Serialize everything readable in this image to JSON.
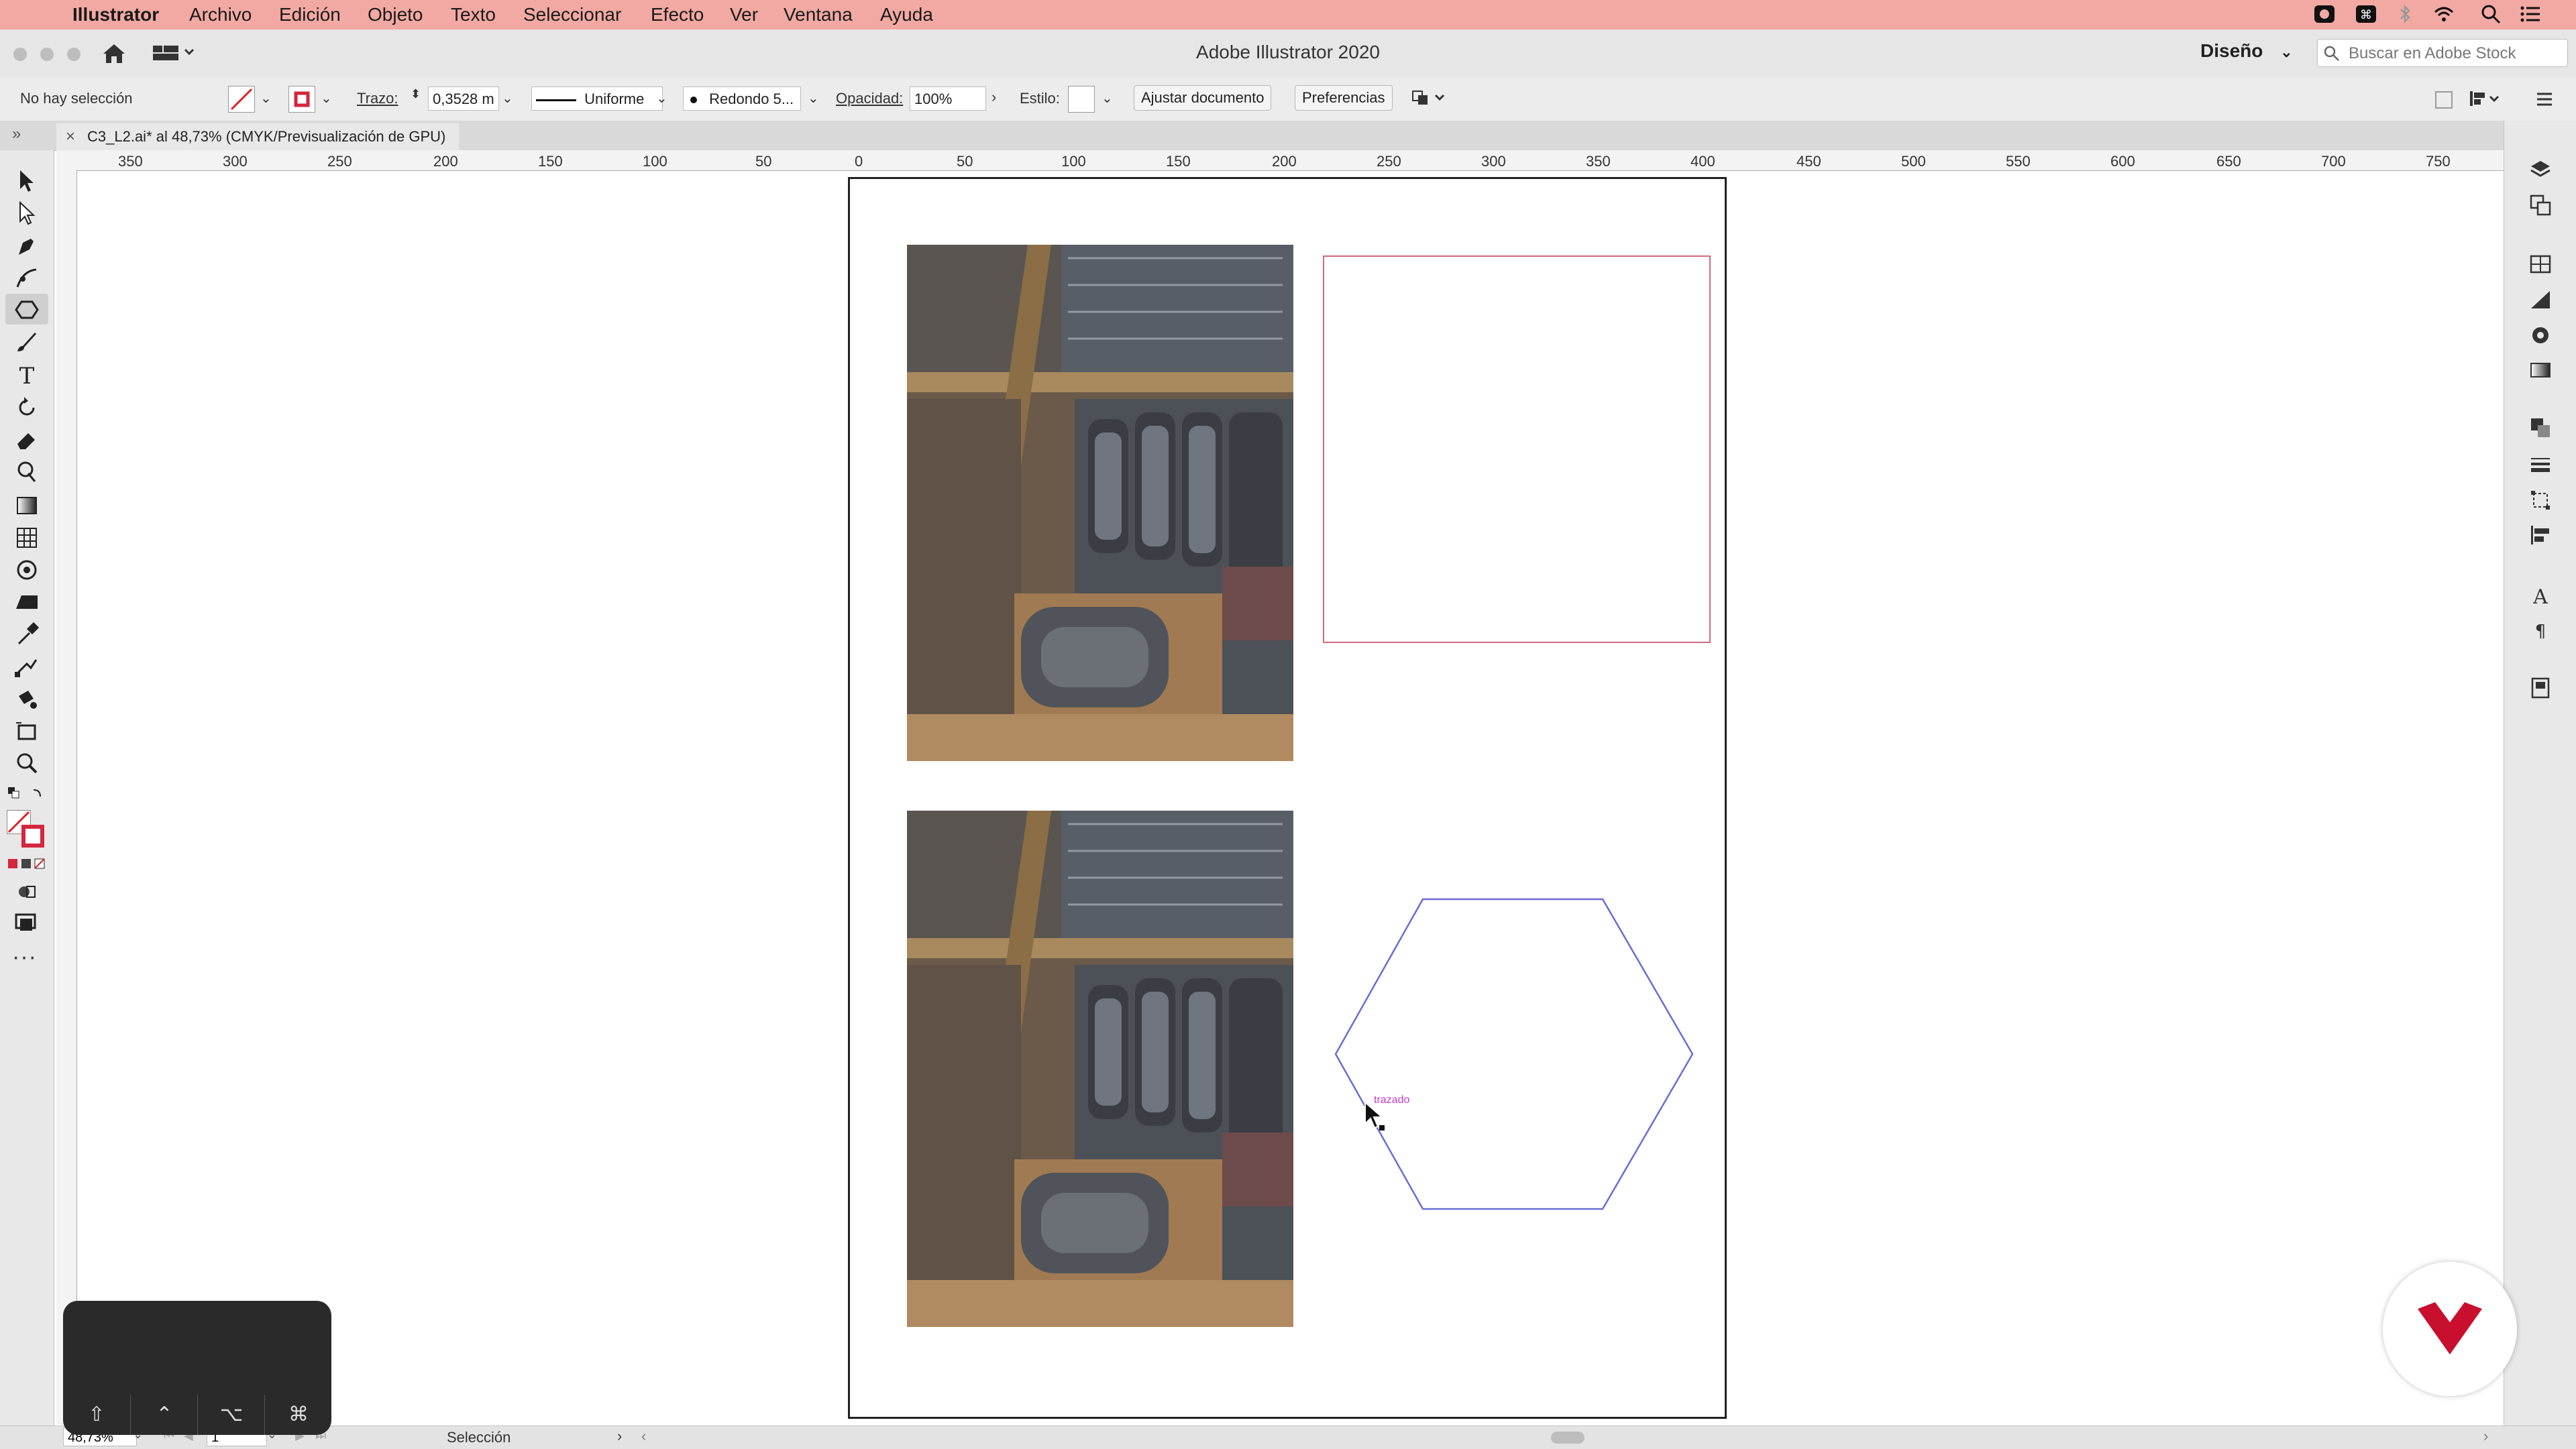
{
  "menubar": {
    "app_name": "Illustrator",
    "items": [
      "Archivo",
      "Edición",
      "Objeto",
      "Texto",
      "Seleccionar",
      "Efecto",
      "Ver",
      "Ventana",
      "Ayuda"
    ]
  },
  "appbar": {
    "title": "Adobe Illustrator 2020",
    "workspace": "Diseño",
    "search_placeholder": "Buscar en Adobe Stock"
  },
  "control": {
    "selection_status": "No hay selección",
    "stroke_label": "Trazo:",
    "stroke_value": "0,3528 m",
    "profile": "Uniforme",
    "brush": "Redondo 5...",
    "opacity_label": "Opacidad:",
    "opacity_value": "100%",
    "style_label": "Estilo:",
    "doc_setup_button": "Ajustar documento",
    "prefs_button": "Preferencias"
  },
  "document": {
    "tab_title": "C3_L2.ai* al 48,73% (CMYK/Previsualización de GPU)"
  },
  "ruler": {
    "h_labels": [
      "350",
      "300",
      "250",
      "200",
      "150",
      "100",
      "50",
      "0",
      "50",
      "100",
      "150",
      "200",
      "250",
      "300",
      "350",
      "400",
      "450",
      "500",
      "550",
      "600",
      "650",
      "700",
      "750"
    ]
  },
  "canvas": {
    "smart_guide_label": "trazado"
  },
  "status": {
    "zoom": "48,73%",
    "artboard": "1",
    "tool": "Selección"
  },
  "colors": {
    "menubar": "#f2a9a3",
    "rectangle_stroke": "#d4697f",
    "hexagon_stroke": "#6b6bd6",
    "smart_guide": "#c03cc0",
    "logo_red": "#c8102e"
  }
}
